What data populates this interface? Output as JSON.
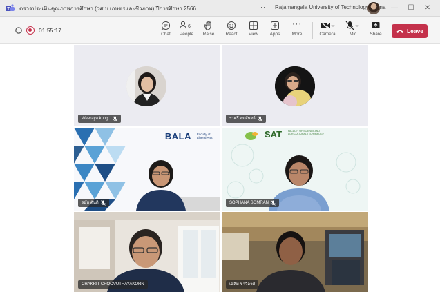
{
  "window": {
    "title": "ตรวจประเมินคุณภาพการศึกษา (วศ.บ.เกษตรและชีวภาพ) ปีการศึกษา 2566",
    "more_label": "···",
    "org": "Rajamangala University of Technology Lanna",
    "minimize": "—",
    "maximize": "☐",
    "close": "✕"
  },
  "toolbar": {
    "timer": "01:55:17",
    "chat": "Chat",
    "people": "People",
    "people_count": "6",
    "raise": "Raise",
    "react": "React",
    "view": "View",
    "apps": "Apps",
    "more": "More",
    "more_icon": "···",
    "camera": "Camera",
    "mic": "Mic",
    "share": "Share",
    "leave": "Leave"
  },
  "colors": {
    "leave": "#c4314b",
    "active_speaker": "#7b83eb"
  },
  "participants": [
    {
      "name": "Weeraya kung..",
      "muted": true
    },
    {
      "name": "ราตรี สมจันทร์",
      "muted": true
    },
    {
      "name": "สมัย ตันติ",
      "muted": true
    },
    {
      "name": "SOPHANA SOMRAN",
      "muted": true
    },
    {
      "name": "CHAKRIT CHOOVUTHAYAKORN",
      "muted": false
    },
    {
      "name": "เฉลิม ขาวิลาศ",
      "muted": false
    }
  ],
  "tiles": {
    "bala_logo": "BALA",
    "bala_logo_sub": "Faculty of Liberal Arts",
    "sat_logo": "SAT",
    "sat_logo_sub": "FACULTY OF SCIENCE AND AGRICULTURAL TECHNOLOGY"
  }
}
